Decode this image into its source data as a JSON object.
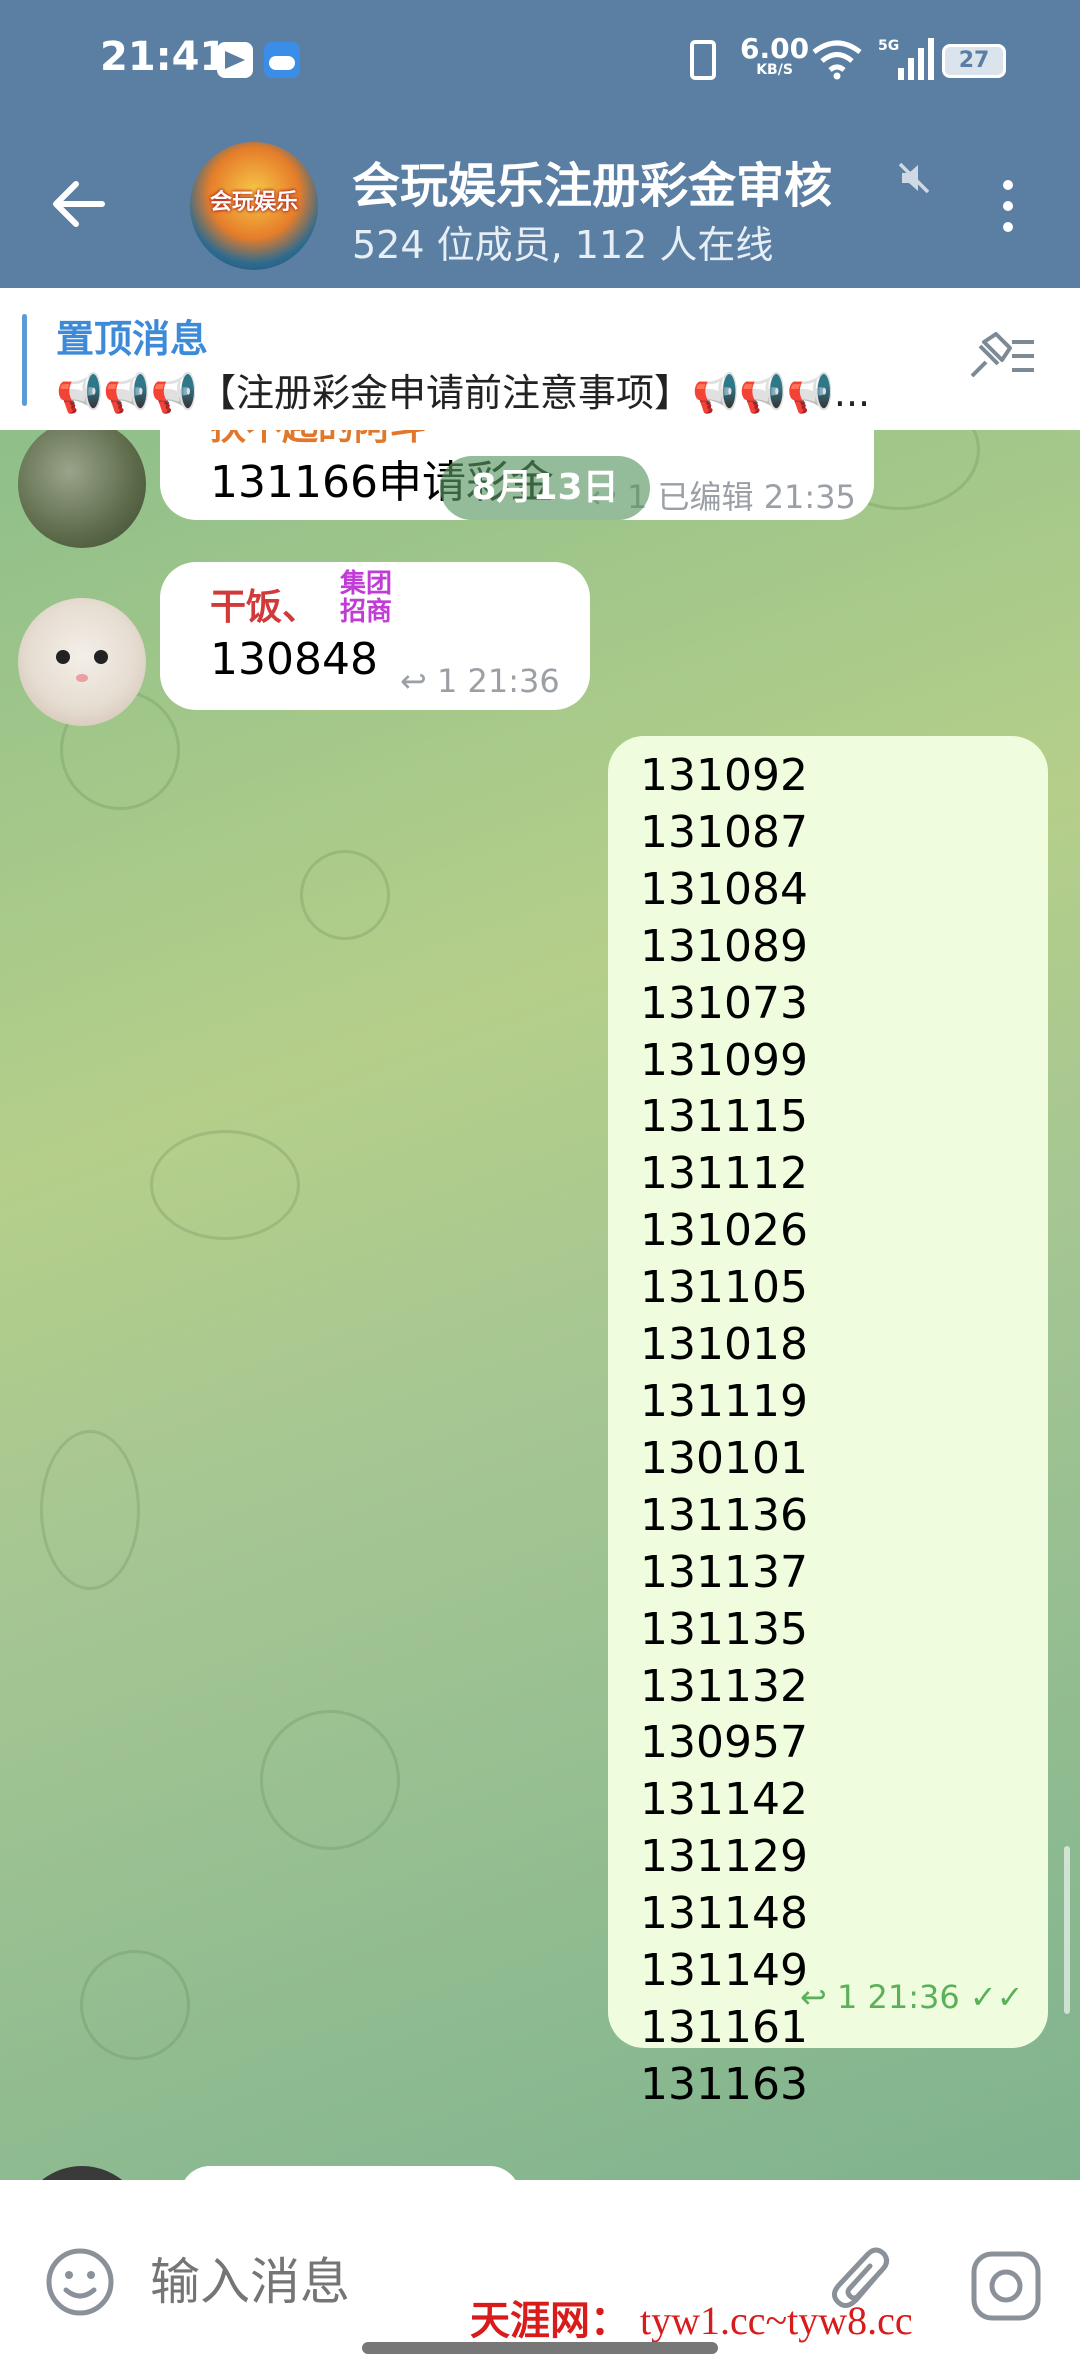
{
  "status_bar": {
    "time": "21:41",
    "speed": "6.00",
    "speed_unit": "KB/S",
    "network": "5G",
    "battery": "27"
  },
  "header": {
    "group_avatar_text": "会玩娱乐",
    "title": "会玩娱乐注册彩金审核",
    "subtitle": "524 位成员, 112 人在线"
  },
  "pinned": {
    "title": "置顶消息",
    "text": "📢📢📢【注册彩金申请前注意事项】📢📢📢..."
  },
  "chat": {
    "date_chip": "8月13日",
    "messages": [
      {
        "sender": "扶不起的阿斗",
        "text": "131166申请彩金",
        "meta": "1 已编辑 21:35",
        "sender_color": "#e0772b"
      },
      {
        "sender": "干饭、",
        "badge_line1": "集团",
        "badge_line2": "招商",
        "text": "130848",
        "meta": "1 21:36",
        "sender_color": "#d23a3a"
      }
    ],
    "outgoing": {
      "numbers": [
        "131092",
        "131087",
        "131084",
        "131089",
        "131073",
        "131099",
        "131115",
        "131112",
        "131026",
        "131105",
        "131018",
        "131119",
        "130101",
        "131136",
        "131137",
        "131135",
        "131132",
        "130957",
        "131142",
        "131129",
        "131148",
        "131149",
        "131161",
        "131163"
      ],
      "meta": "1 21:36"
    }
  },
  "composer": {
    "placeholder": "输入消息",
    "watermark_name": "天涯网：",
    "watermark_site": "tyw1.cc~tyw8.cc"
  },
  "colors": {
    "header_bg": "#5b7fa2",
    "pinned_title": "#3d8ad8",
    "outgoing_bubble": "#effdde",
    "outgoing_meta": "#5bb05a"
  }
}
